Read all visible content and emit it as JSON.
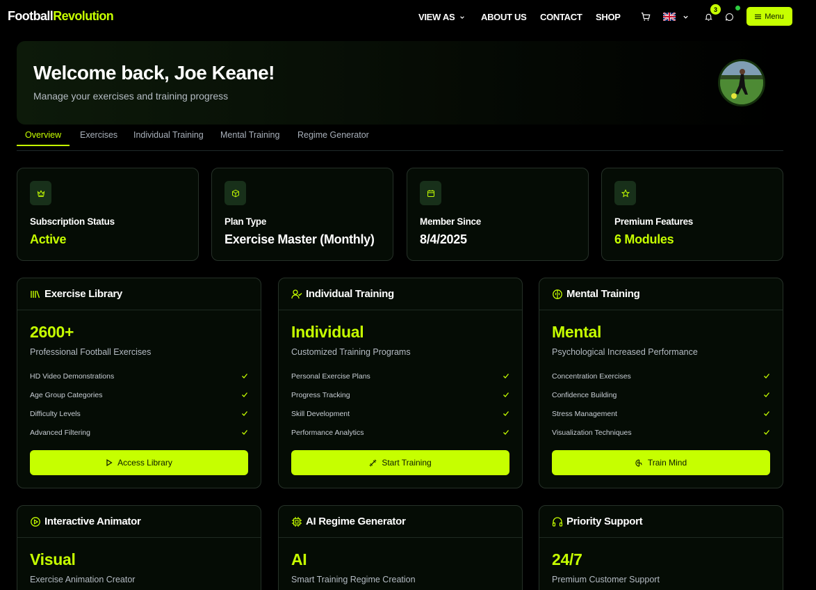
{
  "brand": {
    "part1": "Football",
    "part2": "Revolution"
  },
  "nav": {
    "view_as": "VIEW AS",
    "about": "ABOUT US",
    "contact": "CONTACT",
    "shop": "SHOP",
    "notifications_count": "3",
    "menu_label": "Menu"
  },
  "hero": {
    "title": "Welcome back, Joe Keane!",
    "subtitle": "Manage your exercises and training progress"
  },
  "tabs": [
    "Overview",
    "Exercises",
    "Individual Training",
    "Mental Training",
    "Regime Generator"
  ],
  "stats": [
    {
      "label": "Subscription Status",
      "value": "Active",
      "icon": "crown-icon"
    },
    {
      "label": "Plan Type",
      "value": "Exercise Master (Monthly)",
      "icon": "box-icon"
    },
    {
      "label": "Member Since",
      "value": "8/4/2025",
      "icon": "calendar-icon"
    },
    {
      "label": "Premium Features",
      "value": "6 Modules",
      "icon": "star-icon"
    }
  ],
  "cards": [
    {
      "title": "Exercise Library",
      "icon": "library-icon",
      "big": "2600+",
      "sub": "Professional Football Exercises",
      "items": [
        "HD Video Demonstrations",
        "Age Group Categories",
        "Difficulty Levels",
        "Advanced Filtering"
      ],
      "button": "Access Library",
      "button_icon": "play-icon"
    },
    {
      "title": "Individual Training",
      "icon": "user-check-icon",
      "big": "Individual",
      "sub": "Customized Training Programs",
      "items": [
        "Personal Exercise Plans",
        "Progress Tracking",
        "Skill Development",
        "Performance Analytics"
      ],
      "button": "Start Training",
      "button_icon": "dumbbell-icon"
    },
    {
      "title": "Mental Training",
      "icon": "brain-icon",
      "big": "Mental",
      "sub": "Psychological Increased Performance",
      "items": [
        "Concentration Exercises",
        "Confidence Building",
        "Stress Management",
        "Visualization Techniques"
      ],
      "button": "Train Mind",
      "button_icon": "brain-icon"
    },
    {
      "title": "Interactive Animator",
      "icon": "play-circle-icon",
      "big": "Visual",
      "sub": "Exercise Animation Creator"
    },
    {
      "title": "AI Regime Generator",
      "icon": "cpu-icon",
      "big": "AI",
      "sub": "Smart Training Regime Creation"
    },
    {
      "title": "Priority Support",
      "icon": "headphones-icon",
      "big": "24/7",
      "sub": "Premium Customer Support"
    }
  ],
  "colors": {
    "accent": "#c6ff00",
    "background": "#000000",
    "card": "#050c05"
  }
}
